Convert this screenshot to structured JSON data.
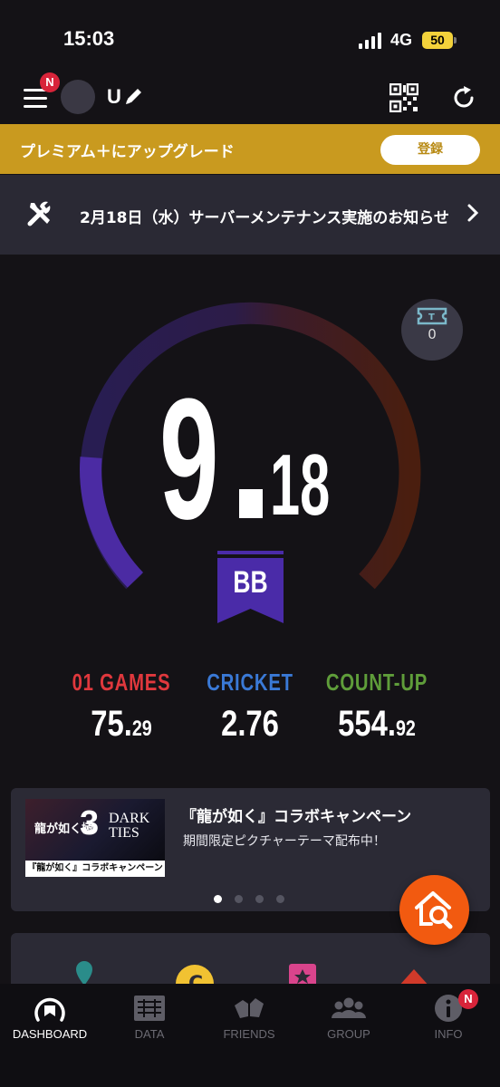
{
  "status_bar": {
    "time": "15:03",
    "network": "4G",
    "battery": "50"
  },
  "header": {
    "menu_badge": "N",
    "username": "U"
  },
  "premium_banner": {
    "text": "プレミアム＋にアップグレード",
    "button_label": "登録"
  },
  "notice": {
    "text": "2月18日（水）サーバーメンテナンス実施のお知らせ"
  },
  "rating": {
    "integer": "9",
    "decimal": "18",
    "class_label": "BB",
    "gauge_fraction": 0.18,
    "ticket_count": "0",
    "colors": {
      "fill": "#4b2ba3",
      "track_left": "#281d52",
      "track_right": "#4a1e0f",
      "flag": "#4a2ba8"
    }
  },
  "stats": [
    {
      "label": "01 GAMES",
      "value_main": "75.",
      "value_small": "29",
      "color": "#e0383d"
    },
    {
      "label": "CRICKET",
      "value_main": "2.76",
      "value_small": "",
      "color": "#3a79d6"
    },
    {
      "label": "COUNT-UP",
      "value_main": "554.",
      "value_small": "92",
      "color": "#5f9d3a"
    }
  ],
  "campaign": {
    "title": "『龍が如く』コラボキャンペーン",
    "subtitle": "期間限定ピクチャーテーマ配布中！",
    "thumb": {
      "logo_text": "龍が如く極",
      "number": "3",
      "dark_ties": "DARK TIES",
      "strip": "『龍が如く』コラボキャンペーン"
    },
    "page_count": 4,
    "active_page": 1
  },
  "tabs": [
    {
      "label": "DASHBOARD",
      "active": true,
      "icon": "dashboard-icon"
    },
    {
      "label": "DATA",
      "active": false,
      "icon": "data-icon"
    },
    {
      "label": "FRIENDS",
      "active": false,
      "icon": "friends-icon"
    },
    {
      "label": "GROUP",
      "active": false,
      "icon": "group-icon"
    },
    {
      "label": "INFO",
      "active": false,
      "icon": "info-icon",
      "badge": "N"
    }
  ],
  "accent": {
    "premium": "#c99a1f",
    "fab": "#f25a10",
    "badge": "#d8243a"
  }
}
